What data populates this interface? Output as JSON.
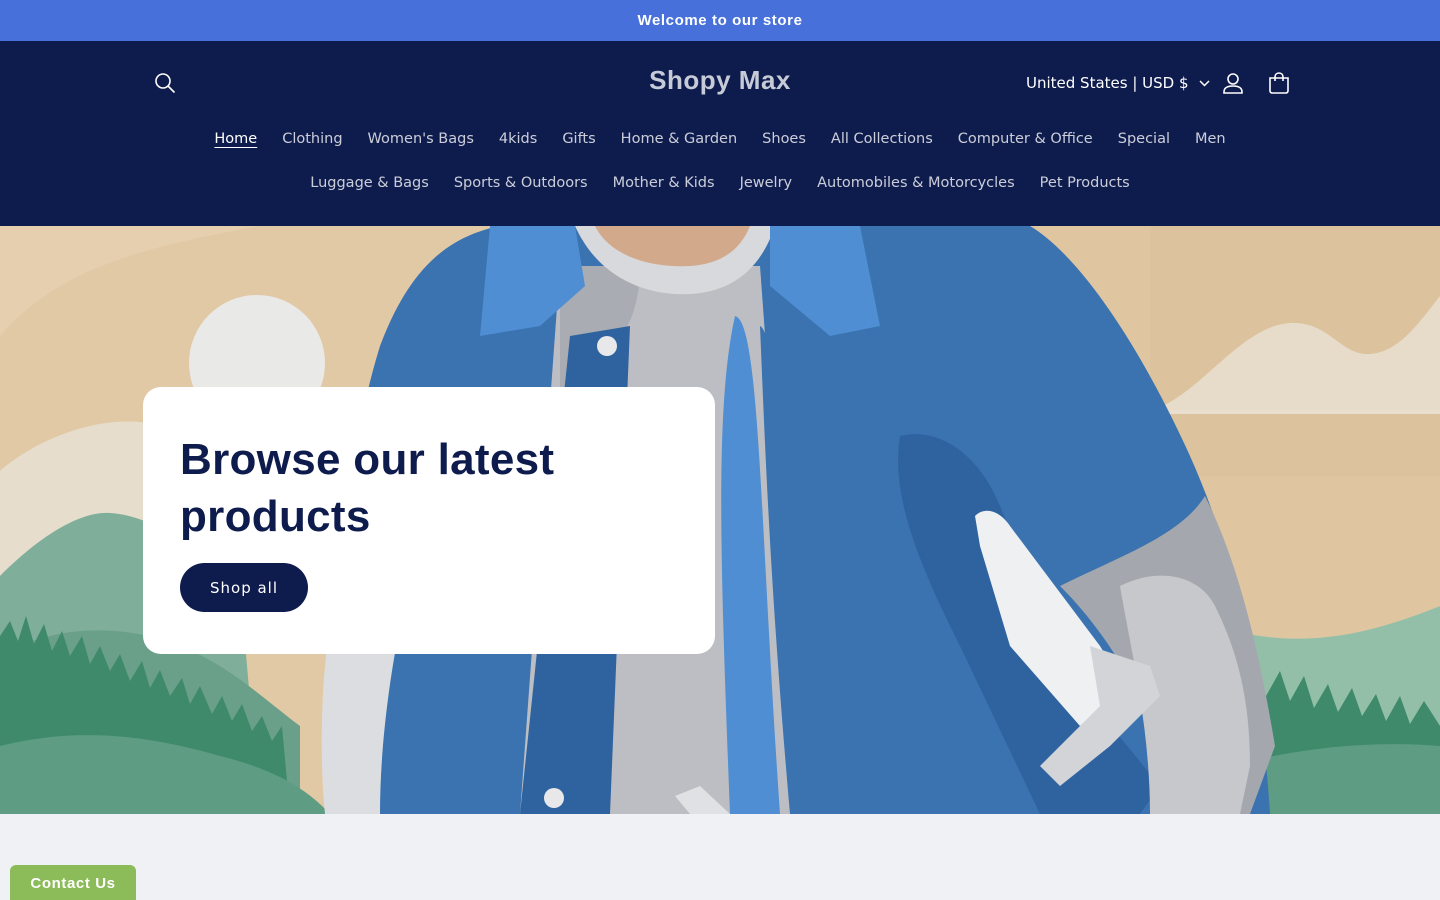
{
  "announcement": {
    "text": "Welcome to our store"
  },
  "header": {
    "logo": "Shopy Max",
    "country_selector": "United States | USD $",
    "icons": {
      "search": "search-icon",
      "account": "account-icon",
      "cart": "cart-icon",
      "chevron": "chevron-down-icon"
    }
  },
  "nav": {
    "row1": [
      {
        "label": "Home",
        "active": true
      },
      {
        "label": "Clothing"
      },
      {
        "label": "Women's Bags"
      },
      {
        "label": "4kids"
      },
      {
        "label": "Gifts"
      },
      {
        "label": "Home & Garden"
      },
      {
        "label": "Shoes"
      },
      {
        "label": "All Collections"
      },
      {
        "label": "Computer & Office"
      },
      {
        "label": "Special"
      },
      {
        "label": "Men"
      }
    ],
    "row2": [
      {
        "label": "Luggage & Bags"
      },
      {
        "label": "Sports & Outdoors"
      },
      {
        "label": "Mother & Kids"
      },
      {
        "label": "Jewelry"
      },
      {
        "label": "Automobiles & Motorcycles"
      },
      {
        "label": "Pet Products"
      }
    ]
  },
  "hero": {
    "title": "Browse our latest products",
    "button_label": "Shop all"
  },
  "contact_tab": {
    "label": "Contact Us"
  },
  "colors": {
    "announcement_bg": "#4770db",
    "header_bg": "#0e1b4d",
    "button_bg": "#0e1b4d",
    "contact_bg": "#8cbb59",
    "page_bg": "#eff1f5"
  }
}
